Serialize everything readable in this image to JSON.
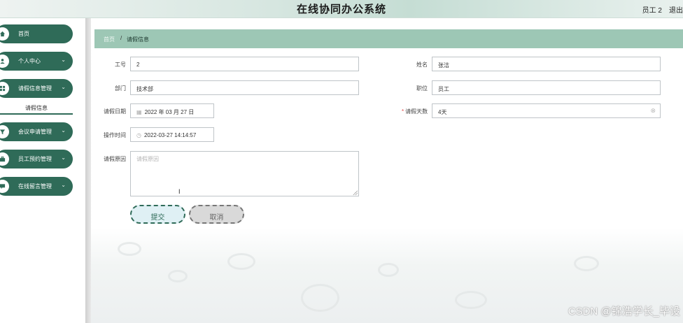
{
  "header": {
    "app_title": "在线协同办公系统",
    "user_name": "员工 2",
    "logout_label": "退出"
  },
  "sidebar": {
    "items": [
      {
        "label": "首页",
        "icon": "home-icon",
        "has_submenu": false
      },
      {
        "label": "个人中心",
        "icon": "user-icon",
        "has_submenu": true
      },
      {
        "label": "请假信息管理",
        "icon": "grid-icon",
        "has_submenu": true,
        "expanded": true
      },
      {
        "label": "会议申请管理",
        "icon": "funnel-icon",
        "has_submenu": true
      },
      {
        "label": "员工预约管理",
        "icon": "briefcase-icon",
        "has_submenu": true
      },
      {
        "label": "在线留言管理",
        "icon": "message-icon",
        "has_submenu": true
      }
    ],
    "active_subitem": "请假信息"
  },
  "breadcrumb": {
    "home": "首页",
    "separator": "/",
    "current": "请假信息"
  },
  "form": {
    "employee_no": {
      "label": "工号",
      "value": "2"
    },
    "name": {
      "label": "姓名",
      "value": "张洁"
    },
    "department": {
      "label": "部门",
      "value": "技术部"
    },
    "position": {
      "label": "职位",
      "value": "员工"
    },
    "leave_date": {
      "label": "请假日期",
      "value": "2022 年 03 月 27 日"
    },
    "leave_days": {
      "label": "请假天数",
      "value": "4天",
      "required": true
    },
    "operation_time": {
      "label": "操作时间",
      "value": "2022-03-27 14:14:57"
    },
    "leave_reason": {
      "label": "请假原因",
      "placeholder": "请假原因",
      "value": ""
    },
    "submit_label": "提交",
    "cancel_label": "取消"
  },
  "watermark": "CSDN @锦浩学长_毕设",
  "colors": {
    "accent": "#2f6b58",
    "breadcrumb_bg": "#9dc7b5",
    "required": "#e24b4b"
  }
}
